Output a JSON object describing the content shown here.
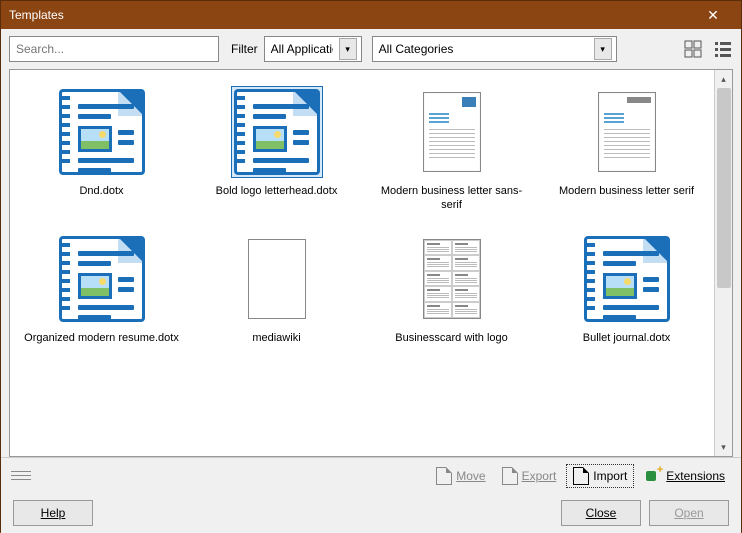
{
  "window": {
    "title": "Templates"
  },
  "toolbar": {
    "search_placeholder": "Search...",
    "filter_label": "Filter",
    "applications_value": "All Applications",
    "categories_value": "All Categories"
  },
  "templates": [
    {
      "label": "Dnd.dotx",
      "thumb": "writer",
      "selected": false
    },
    {
      "label": "Bold logo letterhead.dotx",
      "thumb": "writer",
      "selected": true
    },
    {
      "label": "Modern business letter sans-serif",
      "thumb": "letter-sans",
      "selected": false
    },
    {
      "label": "Modern business letter serif",
      "thumb": "letter-serif",
      "selected": false
    },
    {
      "label": "Organized modern resume.dotx",
      "thumb": "writer",
      "selected": false
    },
    {
      "label": "mediawiki",
      "thumb": "blank",
      "selected": false
    },
    {
      "label": "Businesscard with logo",
      "thumb": "bizcard",
      "selected": false
    },
    {
      "label": "Bullet journal.dotx",
      "thumb": "writer",
      "selected": false
    }
  ],
  "actions": {
    "move": "Move",
    "export": "Export",
    "import": "Import",
    "extensions": "Extensions"
  },
  "buttons": {
    "help": "Help",
    "close": "Close",
    "open": "Open"
  }
}
